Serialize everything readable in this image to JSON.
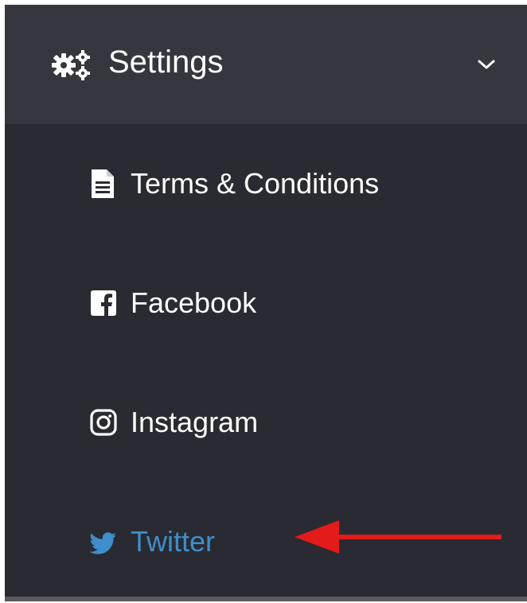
{
  "header": {
    "title": "Settings",
    "icon": "gears-icon",
    "chevron": "chevron-down-icon"
  },
  "menu": {
    "items": [
      {
        "label": "Terms & Conditions",
        "icon": "file-text-icon",
        "active": false
      },
      {
        "label": "Facebook",
        "icon": "facebook-icon",
        "active": false
      },
      {
        "label": "Instagram",
        "icon": "instagram-icon",
        "active": false
      },
      {
        "label": "Twitter",
        "icon": "twitter-icon",
        "active": true
      }
    ]
  },
  "colors": {
    "panel_background": "#2a2a32",
    "header_background": "#36363e",
    "text": "#ffffff",
    "active_text": "#3d8ecb",
    "annotation_arrow": "#e31b1b"
  },
  "annotation": {
    "type": "arrow",
    "points_to": "Twitter"
  }
}
